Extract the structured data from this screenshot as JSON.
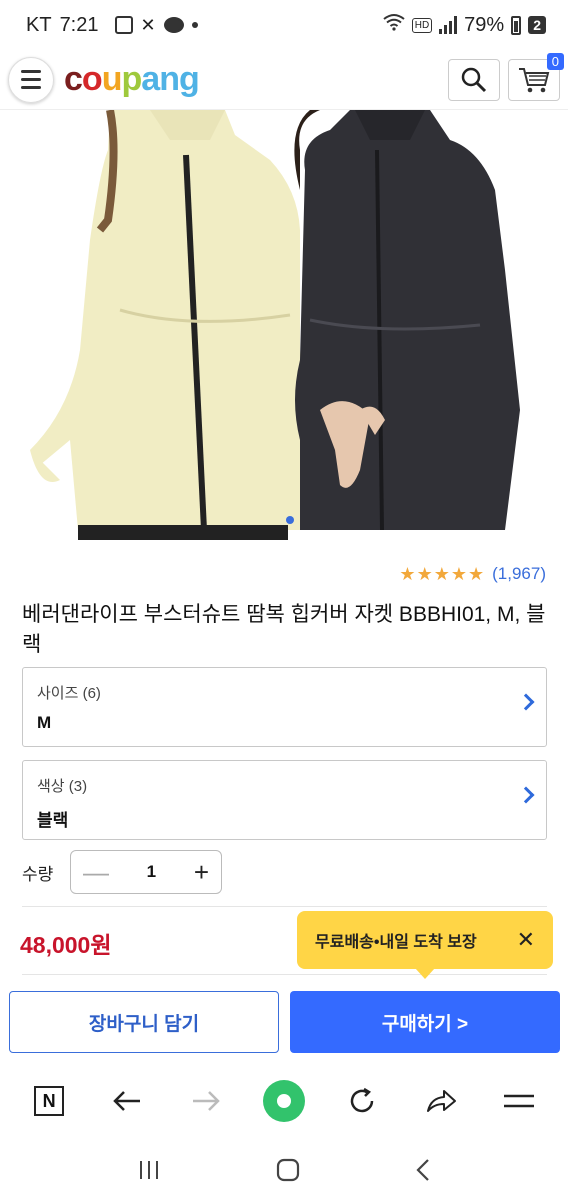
{
  "status_bar": {
    "carrier": "KT",
    "time": "7:21",
    "hd": "HD",
    "battery": "79%",
    "notif_count": "2"
  },
  "header": {
    "logo_letters": [
      {
        "ch": "c",
        "color": "#7a1e1e"
      },
      {
        "ch": "o",
        "color": "#d5282a"
      },
      {
        "ch": "u",
        "color": "#f2a521"
      },
      {
        "ch": "p",
        "color": "#9fc93c"
      },
      {
        "ch": "a",
        "color": "#4fb2e5"
      },
      {
        "ch": "n",
        "color": "#4fb2e5"
      },
      {
        "ch": "g",
        "color": "#4fb2e5"
      }
    ],
    "cart_count": "0"
  },
  "product": {
    "review_count": "(1,967)",
    "stars": 5,
    "title": "베러댄라이프 부스터슈트 땀복 힙커버 자켓 BBBHI01, M, 블랙"
  },
  "options": {
    "size": {
      "label": "사이즈 (6)",
      "value": "M"
    },
    "color": {
      "label": "색상 (3)",
      "value": "블랙"
    }
  },
  "quantity": {
    "label": "수량",
    "minus": "—",
    "value": "1",
    "plus": "+"
  },
  "price": "48,000원",
  "tooltip": {
    "text": "무료배송•내일 도착 보장",
    "close": "✕"
  },
  "actions": {
    "cart": "장바구니 담기",
    "buy": "구매하기 >"
  },
  "colors": {
    "accent": "#346aff",
    "price": "#c8142b",
    "tooltip": "#ffd546",
    "star": "#f2a83b"
  }
}
